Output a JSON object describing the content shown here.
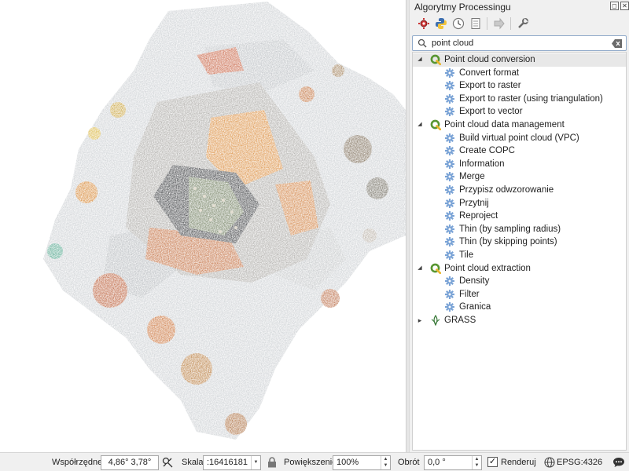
{
  "panel": {
    "title": "Algorytmy Processingu",
    "search": {
      "value": "point cloud",
      "placeholder": ""
    },
    "toolbar": [
      "models-icon",
      "python-icon",
      "history-icon",
      "results-icon",
      "edit-features-icon",
      "options-icon"
    ],
    "tree": [
      {
        "level": 0,
        "type": "group",
        "label": "Point cloud conversion",
        "expanded": true,
        "selected": true
      },
      {
        "level": 1,
        "type": "algorithm",
        "label": "Convert format"
      },
      {
        "level": 1,
        "type": "algorithm",
        "label": "Export to raster"
      },
      {
        "level": 1,
        "type": "algorithm",
        "label": "Export to raster (using triangulation)"
      },
      {
        "level": 1,
        "type": "algorithm",
        "label": "Export to vector"
      },
      {
        "level": 0,
        "type": "group",
        "label": "Point cloud data management",
        "expanded": true
      },
      {
        "level": 1,
        "type": "algorithm",
        "label": "Build virtual point cloud (VPC)"
      },
      {
        "level": 1,
        "type": "algorithm",
        "label": "Create COPC"
      },
      {
        "level": 1,
        "type": "algorithm",
        "label": "Information"
      },
      {
        "level": 1,
        "type": "algorithm",
        "label": "Merge"
      },
      {
        "level": 1,
        "type": "algorithm",
        "label": "Przypisz odwzorowanie"
      },
      {
        "level": 1,
        "type": "algorithm",
        "label": "Przytnij"
      },
      {
        "level": 1,
        "type": "algorithm",
        "label": "Reproject"
      },
      {
        "level": 1,
        "type": "algorithm",
        "label": "Thin (by sampling radius)"
      },
      {
        "level": 1,
        "type": "algorithm",
        "label": "Thin (by skipping points)"
      },
      {
        "level": 1,
        "type": "algorithm",
        "label": "Tile"
      },
      {
        "level": 0,
        "type": "group",
        "label": "Point cloud extraction",
        "expanded": true
      },
      {
        "level": 1,
        "type": "algorithm",
        "label": "Density"
      },
      {
        "level": 1,
        "type": "algorithm",
        "label": "Filter"
      },
      {
        "level": 1,
        "type": "algorithm",
        "label": "Granica"
      },
      {
        "level": 0,
        "type": "provider",
        "label": "GRASS",
        "expanded": false
      }
    ]
  },
  "statusbar": {
    "coords_label": "Współrzędne",
    "coords_value": "4,86° 3,78°",
    "scale_label": "Skala",
    "scale_value": ":16416181",
    "magnifier_label": "Powiększenie",
    "magnifier_value": "100%",
    "rotation_label": "Obrót",
    "rotation_value": "0,0 °",
    "render_label": "Renderuj",
    "render_checked": true,
    "crs": "EPSG:4326"
  },
  "colors": {
    "qgis_green": "#589632",
    "gear_blue": "#7aa3d6",
    "selection": "#e8e8e8"
  }
}
